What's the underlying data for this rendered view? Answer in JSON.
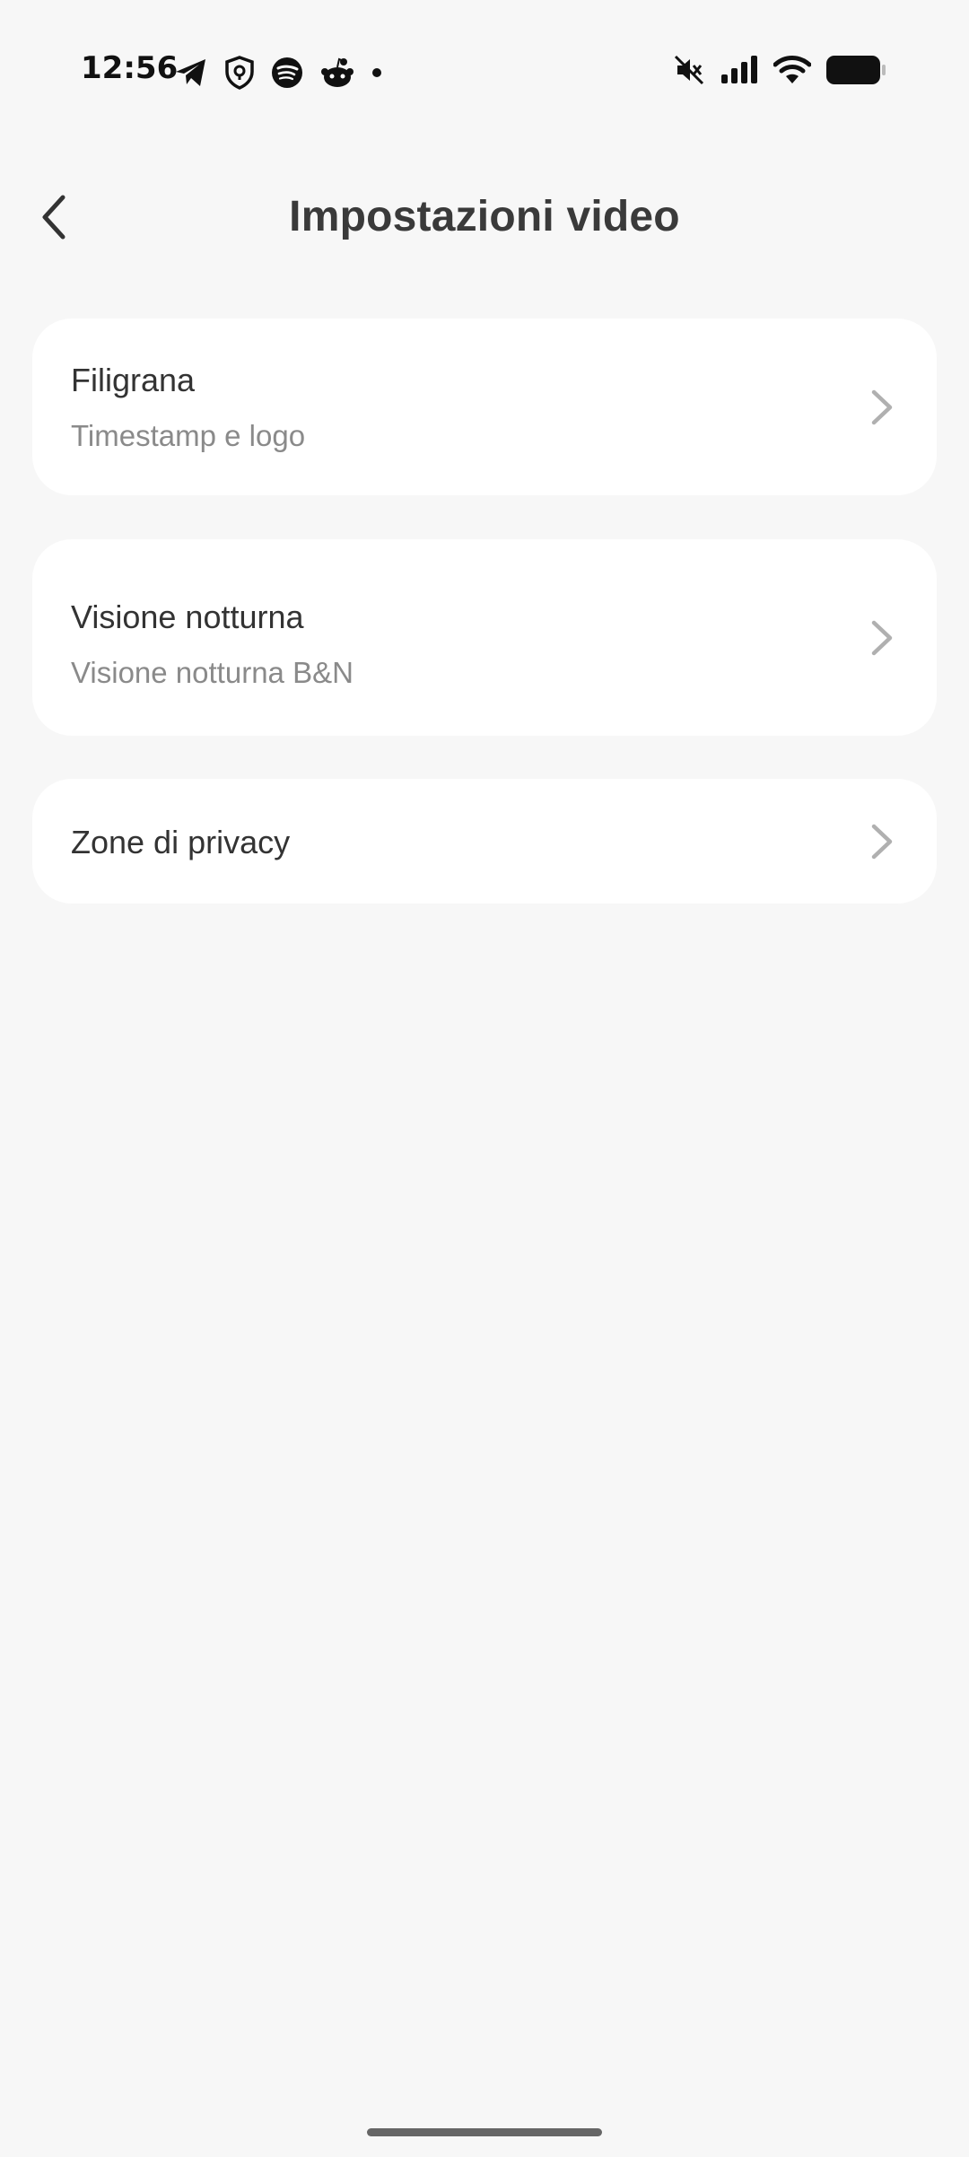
{
  "status_bar": {
    "time": "12:56",
    "left_icons": [
      "telegram-icon",
      "shield-icon",
      "spotify-icon",
      "reddit-icon",
      "dot-icon"
    ],
    "right_icons": [
      "mute-icon",
      "signal-icon",
      "wifi-icon",
      "battery-icon"
    ]
  },
  "header": {
    "title": "Impostazioni video"
  },
  "settings": [
    {
      "title": "Filigrana",
      "subtitle": "Timestamp e logo"
    },
    {
      "title": "Visione notturna",
      "subtitle": "Visione notturna B&N"
    },
    {
      "title": "Zone di privacy"
    }
  ],
  "colors": {
    "background": "#f7f7f7",
    "card": "#ffffff",
    "title_text": "#333333",
    "subtitle_text": "#8a8a8a",
    "chevron": "#b0b0b0"
  }
}
